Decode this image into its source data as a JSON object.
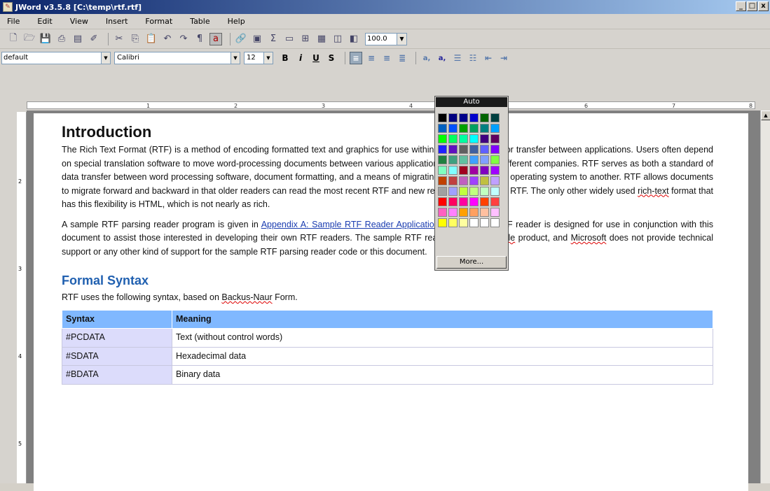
{
  "window": {
    "title": "JWord v3.5.8 [C:\\temp\\rtf.rtf]",
    "min": "_",
    "max": "□",
    "close": "x"
  },
  "menu": [
    "File",
    "Edit",
    "View",
    "Insert",
    "Format",
    "Table",
    "Help"
  ],
  "toolbar": {
    "zoom_value": "100.0",
    "style_value": "default",
    "font_value": "Calibri",
    "size_value": "12",
    "bold": "B",
    "italic": "i",
    "underline": "U",
    "strike": "S"
  },
  "ruler": {
    "marks": [
      "1",
      "2",
      "3",
      "4",
      "6",
      "7",
      "8"
    ],
    "vmarks": [
      "2",
      "3",
      "4",
      "5"
    ]
  },
  "color_popup": {
    "auto_label": "Auto",
    "more_label": "More...",
    "swatches": [
      "#000000",
      "#000080",
      "#00008b",
      "#0000cd",
      "#006400",
      "#004040",
      "#0060c0",
      "#0050ff",
      "#00a000",
      "#00a060",
      "#008080",
      "#00a0ff",
      "#00ff00",
      "#00ff60",
      "#00ffa0",
      "#00ffff",
      "#400080",
      "#600060",
      "#2020ff",
      "#6010c0",
      "#606060",
      "#4060a0",
      "#6060ff",
      "#8000ff",
      "#208040",
      "#40a080",
      "#60c0a0",
      "#40a0ff",
      "#80a0ff",
      "#80ff40",
      "#80ffc0",
      "#80ffff",
      "#a00020",
      "#a000a0",
      "#8000c0",
      "#a000ff",
      "#c04000",
      "#c04040",
      "#c060c0",
      "#a040ff",
      "#c0c040",
      "#c0a0ff",
      "#a0a0a0",
      "#a0a0ff",
      "#c0ff40",
      "#c0ff80",
      "#c0ffc0",
      "#c0ffff",
      "#ff0000",
      "#ff0060",
      "#ff00a0",
      "#ff00ff",
      "#ff4000",
      "#ff4040",
      "#ff60c0",
      "#ff80ff",
      "#ffa000",
      "#ffa060",
      "#ffc0a0",
      "#ffc0ff",
      "#ffff00",
      "#ffff60",
      "#ffffa0",
      "#ffffff",
      "#ffffff",
      "#ffffff"
    ]
  },
  "doc": {
    "h1": "Introduction",
    "p1_a": "The Rich Text Format (RTF) is a method of encoding formatted text and graphics for use within applications and for transfer between applications. Users often depend on special translation software to move word-processing documents between various applications developed by different companies. RTF serves as both a standard of data transfer between word processing software, document formatting, and a means of migrating content from one operating system to another. RTF allows documents to migrate forward and backward in that older readers can read the most recent RTF and new readers can read old RTF. The only other widely used ",
    "p1_squig": "rich-text",
    "p1_b": " format that has this flexibility is HTML, which is not nearly as rich.",
    "p2_a": "A sample RTF parsing reader program is given in ",
    "p2_link": "Appendix A: Sample RTF Reader Application",
    "p2_b": ". This sample RTF reader is designed for use in conjunction with this document to assist those interested in developing their own RTF readers. The sample RTF reader is not a ",
    "p2_squig1": "for-sale",
    "p2_c": " product, and ",
    "p2_squig2": "Microsoft",
    "p2_d": " does not provide technical support or any other kind of support for the sample RTF parsing reader code or this document.",
    "h2": "Formal Syntax",
    "p3_a": "RTF uses the following syntax, based on ",
    "p3_squig": "Backus-Naur",
    "p3_b": " Form.",
    "table": {
      "headers": [
        "Syntax",
        "Meaning"
      ],
      "rows": [
        [
          "#PCDATA",
          "Text (without control words)"
        ],
        [
          "#SDATA",
          "Hexadecimal data"
        ],
        [
          "#BDATA",
          "Binary data"
        ]
      ]
    }
  }
}
